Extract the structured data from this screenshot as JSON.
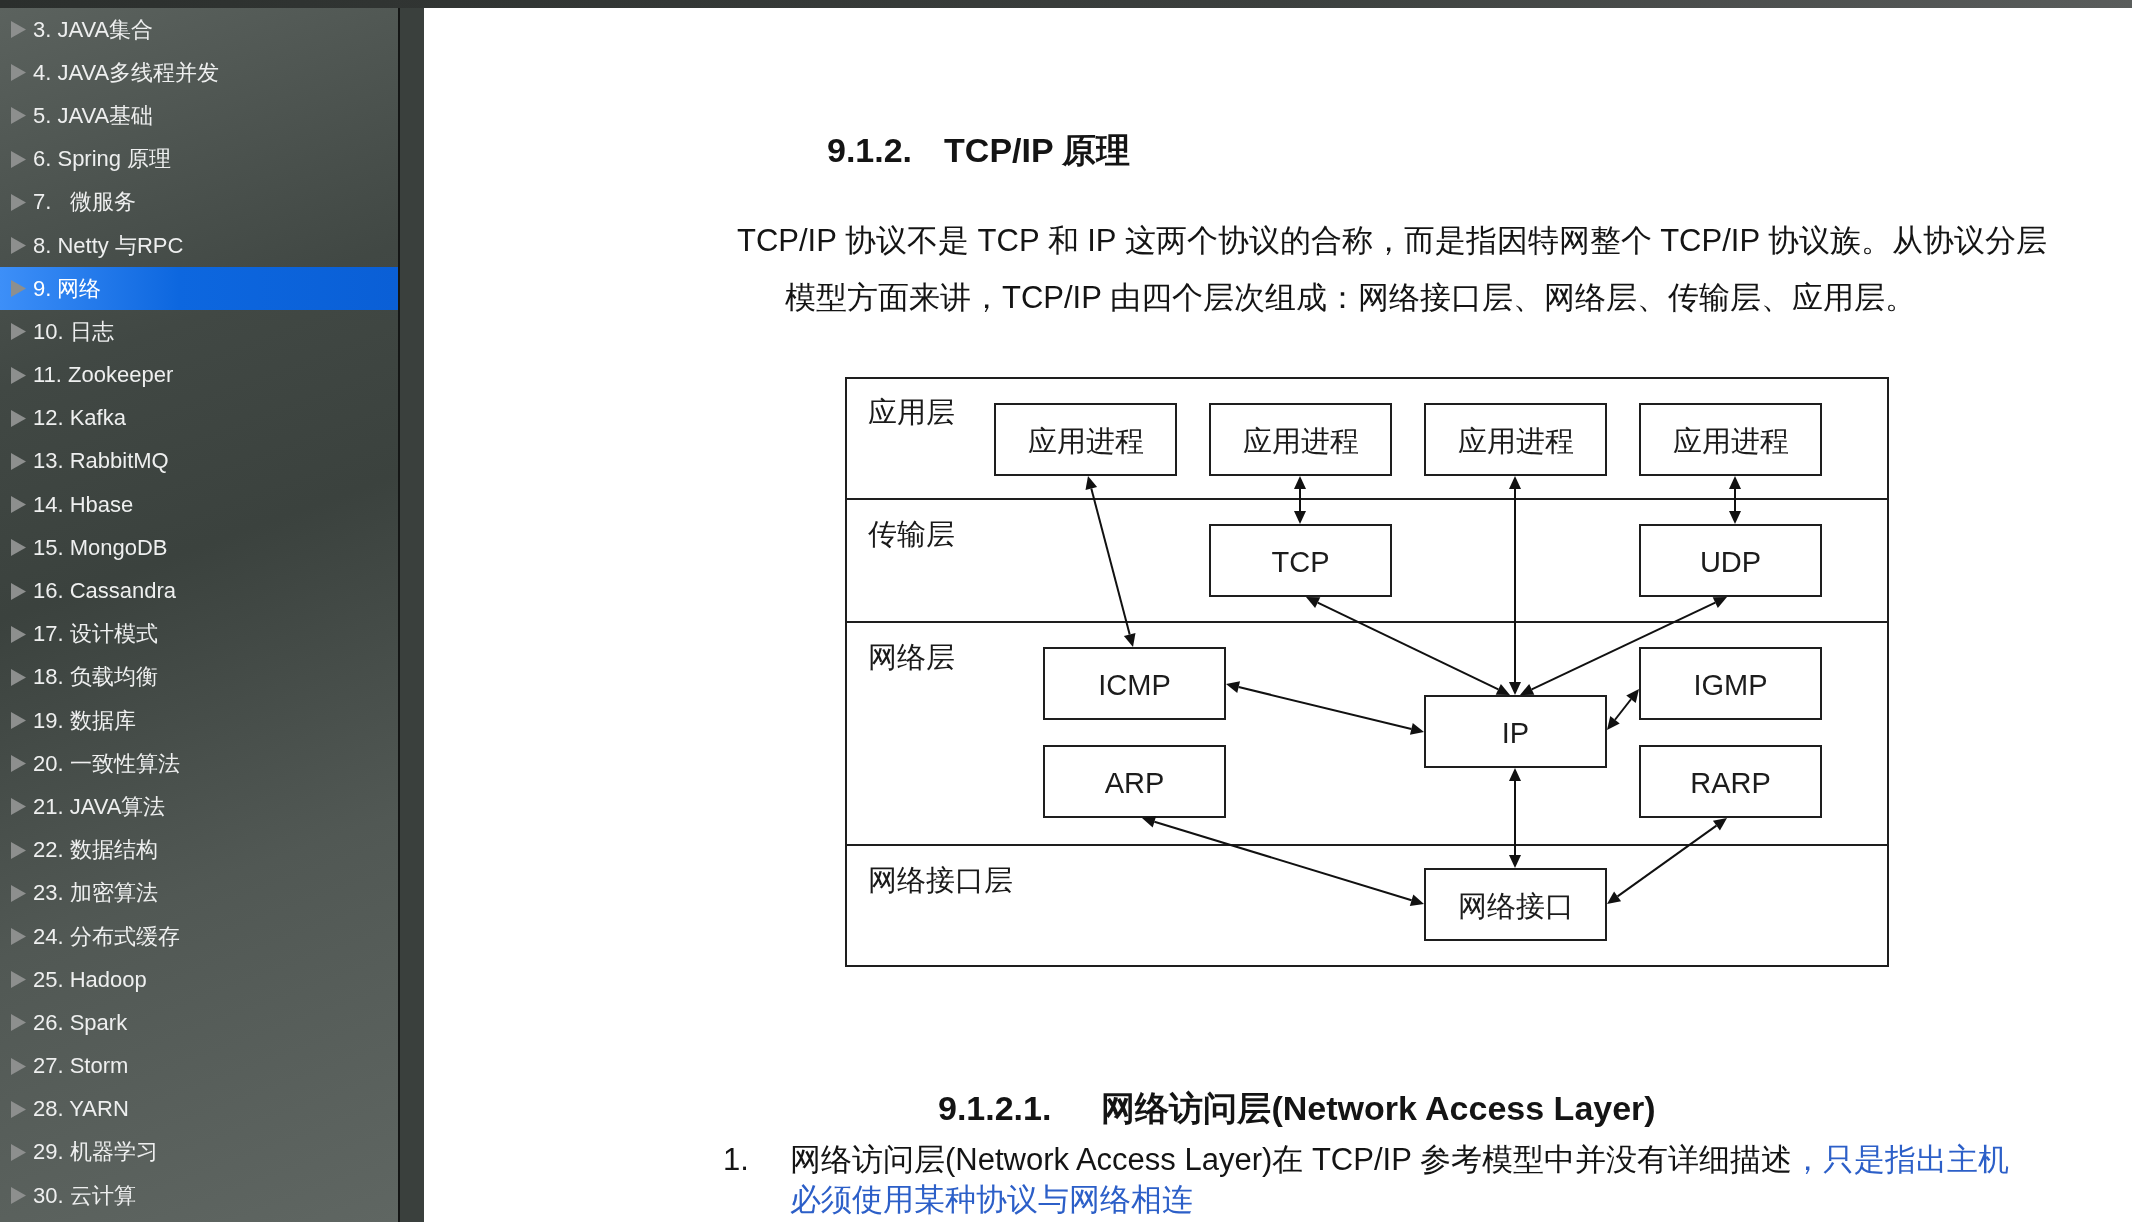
{
  "sidebar": {
    "items": [
      {
        "label": "3. JAVA集合",
        "selected": false,
        "expanded": false
      },
      {
        "label": "4. JAVA多线程并发",
        "selected": false,
        "expanded": false
      },
      {
        "label": "5. JAVA基础",
        "selected": false,
        "expanded": false
      },
      {
        "label": "6. Spring 原理",
        "selected": false,
        "expanded": false
      },
      {
        "label": "7.   微服务",
        "selected": false,
        "expanded": false
      },
      {
        "label": "8. Netty 与RPC",
        "selected": false,
        "expanded": false
      },
      {
        "label": "9. 网络",
        "selected": true,
        "expanded": false
      },
      {
        "label": "10. 日志",
        "selected": false,
        "expanded": false
      },
      {
        "label": "11. Zookeeper",
        "selected": false,
        "expanded": false
      },
      {
        "label": "12. Kafka",
        "selected": false,
        "expanded": false
      },
      {
        "label": "13. RabbitMQ",
        "selected": false,
        "expanded": false
      },
      {
        "label": "14. Hbase",
        "selected": false,
        "expanded": false
      },
      {
        "label": "15. MongoDB",
        "selected": false,
        "expanded": false
      },
      {
        "label": "16. Cassandra",
        "selected": false,
        "expanded": false
      },
      {
        "label": "17. 设计模式",
        "selected": false,
        "expanded": false
      },
      {
        "label": "18. 负载均衡",
        "selected": false,
        "expanded": false
      },
      {
        "label": "19. 数据库",
        "selected": false,
        "expanded": false
      },
      {
        "label": "20. 一致性算法",
        "selected": false,
        "expanded": false
      },
      {
        "label": "21. JAVA算法",
        "selected": false,
        "expanded": false
      },
      {
        "label": "22. 数据结构",
        "selected": false,
        "expanded": false
      },
      {
        "label": "23. 加密算法",
        "selected": false,
        "expanded": false
      },
      {
        "label": "24. 分布式缓存",
        "selected": false,
        "expanded": false
      },
      {
        "label": "25. Hadoop",
        "selected": false,
        "expanded": false
      },
      {
        "label": "26. Spark",
        "selected": false,
        "expanded": false
      },
      {
        "label": "27. Storm",
        "selected": false,
        "expanded": false
      },
      {
        "label": "28. YARN",
        "selected": false,
        "expanded": false
      },
      {
        "label": "29. 机器学习",
        "selected": false,
        "expanded": false
      },
      {
        "label": "30. 云计算",
        "selected": false,
        "expanded": false
      }
    ]
  },
  "document": {
    "heading": {
      "number": "9.1.2.",
      "title": "TCP/IP 原理"
    },
    "paragraph": "TCP/IP 协议不是 TCP 和 IP 这两个协议的合称，而是指因特网整个 TCP/IP 协议族。从协议分层模型方面来讲，TCP/IP 由四个层次组成：网络接口层、网络层、传输层、应用层。",
    "diagram": {
      "layers": [
        {
          "label": "应用层",
          "nodes": [
            "应用进程",
            "应用进程",
            "应用进程",
            "应用进程"
          ]
        },
        {
          "label": "传输层",
          "nodes": [
            "TCP",
            "UDP"
          ]
        },
        {
          "label": "网络层",
          "nodes": [
            "ICMP",
            "IP",
            "IGMP",
            "ARP",
            "RARP"
          ]
        },
        {
          "label": "网络接口层",
          "nodes": [
            "网络接口"
          ]
        }
      ]
    },
    "subheading": {
      "number": "9.1.2.1.",
      "title": "网络访问层(Network Access Layer)"
    },
    "list": [
      {
        "marker": "1.",
        "text": "网络访问层(Network Access Layer)在 TCP/IP 参考模型中并没有详细描述",
        "highlighted_text": "，只是指出主机必须使用某种协议与网络相连"
      }
    ]
  }
}
